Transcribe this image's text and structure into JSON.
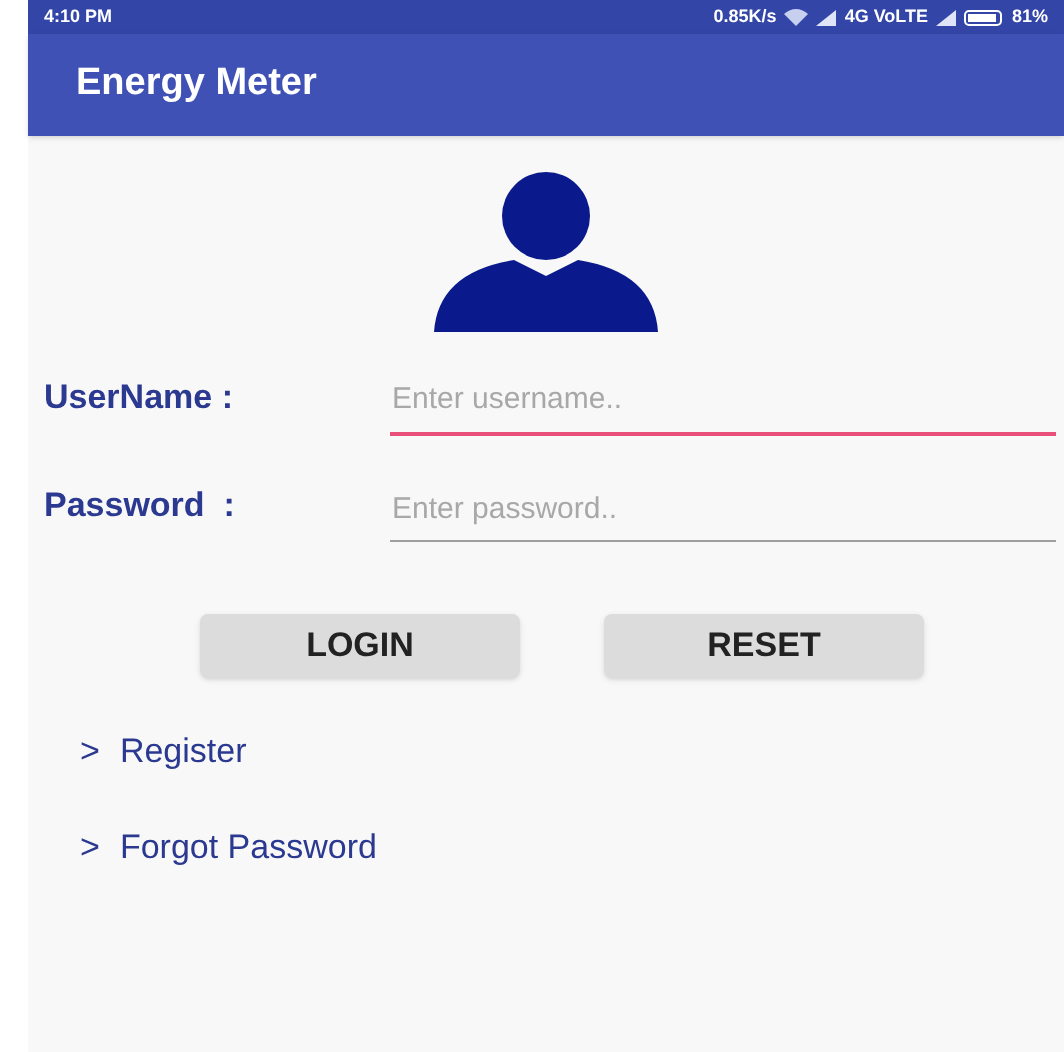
{
  "status_bar": {
    "time": "4:10 PM",
    "speed": "0.85K/s",
    "network": "4G VoLTE",
    "battery": "81%"
  },
  "app_bar": {
    "title": "Energy Meter"
  },
  "fields": [
    {
      "label": "UserName :",
      "placeholder": "Enter username..",
      "focused": true
    },
    {
      "label": "Password  :",
      "placeholder": "Enter password..",
      "focused": false
    }
  ],
  "buttons": [
    "LOGIN",
    "RESET"
  ],
  "links": [
    {
      "marker": ">",
      "text": "Register"
    },
    {
      "marker": ">",
      "text": "Forgot Password"
    }
  ]
}
